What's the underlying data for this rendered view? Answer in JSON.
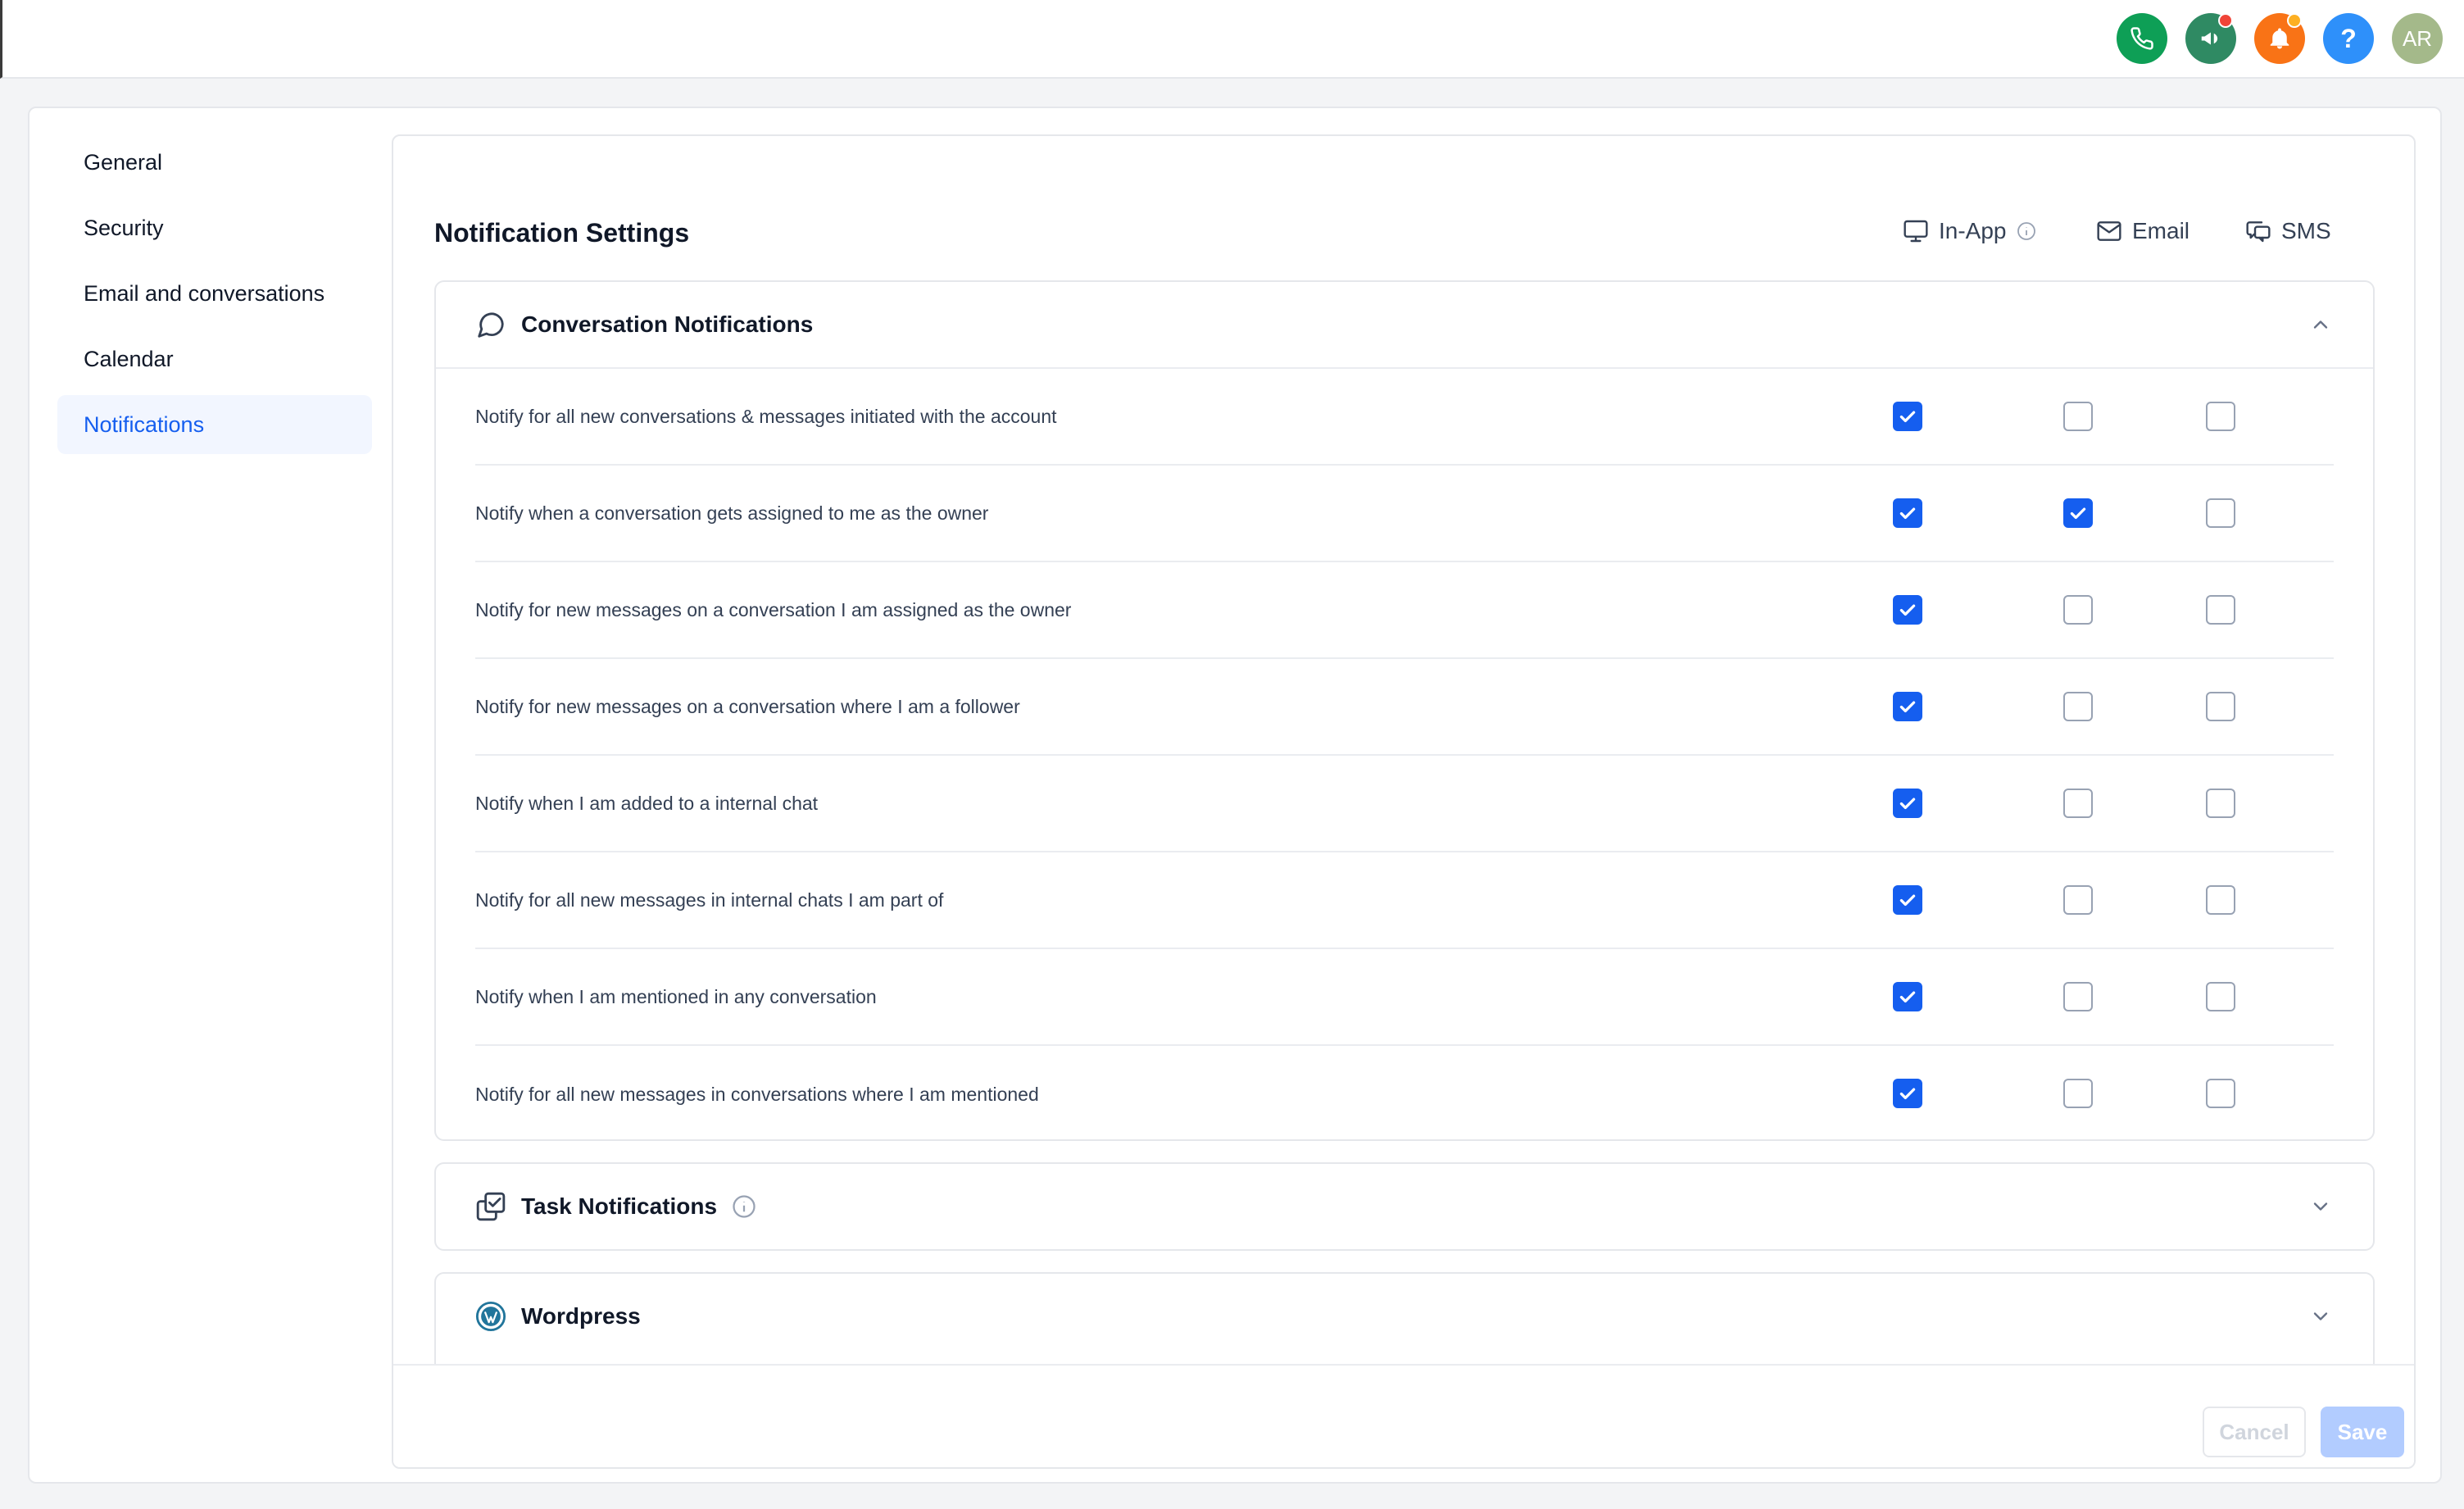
{
  "topbar": {
    "icons": [
      {
        "name": "phone-icon",
        "color": "#0e9f56"
      },
      {
        "name": "megaphone-icon",
        "color": "#2f8a63",
        "badge_color": "#f04438"
      },
      {
        "name": "bell-icon",
        "color": "#f97316",
        "badge_color": "#fdb022"
      },
      {
        "name": "help-icon",
        "color": "#2e90fa"
      }
    ],
    "avatar": {
      "initials": "AR",
      "color": "#a4b98a"
    }
  },
  "sidebar": {
    "items": [
      {
        "label": "General"
      },
      {
        "label": "Security"
      },
      {
        "label": "Email and conversations"
      },
      {
        "label": "Calendar"
      },
      {
        "label": "Notifications",
        "active": true
      }
    ]
  },
  "panel": {
    "title": "Notification Settings",
    "channels": [
      {
        "label": "In-App",
        "icon": "monitor-icon"
      },
      {
        "label": "Email",
        "icon": "mail-icon"
      },
      {
        "label": "SMS",
        "icon": "sms-icon"
      }
    ]
  },
  "conversation": {
    "title": "Conversation Notifications",
    "icon": "chat-bubble-icon",
    "expanded": true,
    "rows": [
      {
        "label": "Notify for all new conversations & messages initiated with the account",
        "inapp": true,
        "email": false,
        "sms": false
      },
      {
        "label": "Notify when a conversation gets assigned to me as the owner",
        "inapp": true,
        "email": true,
        "sms": false
      },
      {
        "label": "Notify for new messages on a conversation I am assigned as the owner",
        "inapp": true,
        "email": false,
        "sms": false
      },
      {
        "label": "Notify for new messages on a conversation where I am a follower",
        "inapp": true,
        "email": false,
        "sms": false
      },
      {
        "label": "Notify when I am added to a internal chat",
        "inapp": true,
        "email": false,
        "sms": false
      },
      {
        "label": "Notify for all new messages in internal chats I am part of",
        "inapp": true,
        "email": false,
        "sms": false
      },
      {
        "label": "Notify when I am mentioned in any conversation",
        "inapp": true,
        "email": false,
        "sms": false
      },
      {
        "label": "Notify for all new messages in conversations where I am mentioned",
        "inapp": true,
        "email": false,
        "sms": false
      }
    ]
  },
  "task": {
    "title": "Task Notifications",
    "icon": "task-icon"
  },
  "wordpress": {
    "title": "Wordpress",
    "icon": "wordpress-icon"
  },
  "footer": {
    "cancel_label": "Cancel",
    "save_label": "Save"
  },
  "colors": {
    "accent": "#155eef",
    "border": "#e5e7eb",
    "save_disabled": "#b2ccff"
  }
}
